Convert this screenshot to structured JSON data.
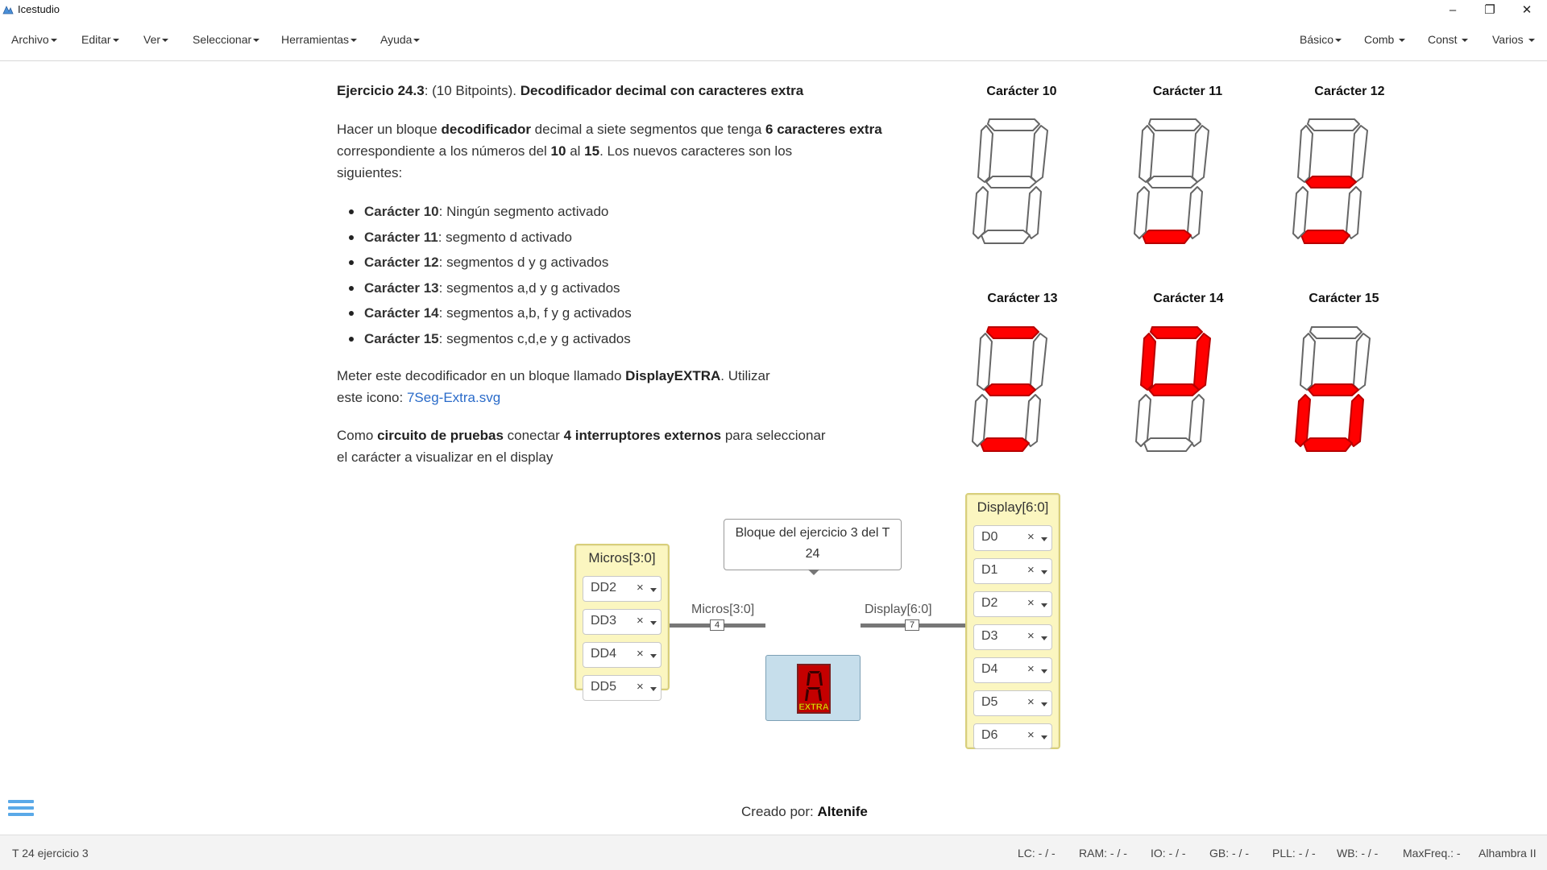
{
  "window": {
    "title": "Icestudio",
    "minimize": "–",
    "maximize": "❐",
    "close": "✕"
  },
  "menu": {
    "left": [
      "Archivo",
      "Editar",
      "Ver",
      "Seleccionar",
      "Herramientas",
      "Ayuda"
    ],
    "right": [
      "Básico",
      "Comb",
      "Const",
      "Varios"
    ]
  },
  "exercise": {
    "heading_code": "Ejercicio 24.3",
    "heading_points": ": (10 Bitpoints). ",
    "heading_title": "Decodificador decimal con caracteres extra",
    "p1_a": "Hacer un bloque ",
    "p1_b": "decodificador",
    "p1_c": " decimal a siete segmentos que tenga ",
    "p1_d": "6 caracteres extra",
    "p1_e": "correspondiente a los números del ",
    "p1_f": "10",
    "p1_g": " al ",
    "p1_h": "15",
    "p1_i": ". Los nuevos caracteres son los",
    "p1_j": "siguientes:",
    "bullets": [
      {
        "name": "Carácter 10",
        "desc": ": Ningún segmento activado"
      },
      {
        "name": "Carácter 11",
        "desc": ": segmento d activado"
      },
      {
        "name": "Carácter 12",
        "desc": ": segmentos d y g activados"
      },
      {
        "name": "Carácter 13",
        "desc": ": segmentos a,d y g activados"
      },
      {
        "name": "Carácter 14",
        "desc": ": segmentos a,b, f y g activados"
      },
      {
        "name": "Carácter 15",
        "desc": ": segmentos c,d,e y g activados"
      }
    ],
    "p2_a": "Meter este decodificador en un bloque llamado ",
    "p2_b": "DisplayEXTRA",
    "p2_c": ". Utilizar",
    "p2_d": "este icono: ",
    "p2_link": "7Seg-Extra.svg",
    "p3_a": "Como ",
    "p3_b": "circuito de pruebas",
    "p3_c": " conectar ",
    "p3_d": "4 interruptores externos",
    "p3_e": " para seleccionar",
    "p3_f": "el carácter a visualizar en el display"
  },
  "characters": [
    {
      "title": "Carácter 10",
      "active": []
    },
    {
      "title": "Carácter 11",
      "active": [
        "d"
      ]
    },
    {
      "title": "Carácter 12",
      "active": [
        "d",
        "g"
      ]
    },
    {
      "title": "Carácter 13",
      "active": [
        "a",
        "d",
        "g"
      ]
    },
    {
      "title": "Carácter 14",
      "active": [
        "a",
        "b",
        "f",
        "g"
      ]
    },
    {
      "title": "Carácter 15",
      "active": [
        "c",
        "d",
        "e",
        "g"
      ]
    }
  ],
  "circuit": {
    "input_block": {
      "title": "Micros[3:0]",
      "pins": [
        "DD2",
        "DD3",
        "DD4",
        "DD5"
      ]
    },
    "output_block": {
      "title": "Display[6:0]",
      "pins": [
        "D0",
        "D1",
        "D2",
        "D3",
        "D4",
        "D5",
        "D6"
      ]
    },
    "comment_line1": "Bloque del ejercicio 3 del T",
    "comment_line2": "24",
    "wire_in_label": "Micros[3:0]",
    "wire_in_size": "4",
    "wire_out_label": "Display[6:0]",
    "wire_out_size": "7",
    "module_icon_text": "EXTRA",
    "pin_clear": "×"
  },
  "credit": {
    "label": "Creado por: ",
    "author": "Altenife"
  },
  "footer": {
    "project": "T 24 ejercicio 3",
    "lc": "LC:  - / -",
    "ram": "RAM:  - / -",
    "io": "IO:  - / -",
    "gb": "GB:  - / -",
    "pll": "PLL:  - / -",
    "wb": "WB:  - / -",
    "maxfreq": "MaxFreq.:  -",
    "board": "Alhambra II"
  },
  "colors": {
    "segment_on": "#ff0000",
    "segment_off": "#ffffff",
    "io_block": "#fbf6c0",
    "module": "#c6deeb",
    "link": "#2a6bc9",
    "hamburger": "#5aa9e8"
  }
}
